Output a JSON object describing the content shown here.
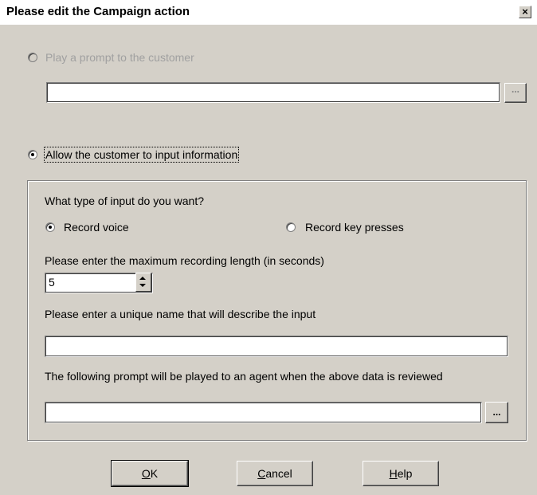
{
  "window": {
    "title": "Please edit the Campaign action",
    "close_glyph": "✕"
  },
  "play_prompt": {
    "label": "Play a prompt to the customer",
    "value": "",
    "browse_label": "..."
  },
  "allow_input": {
    "label": "Allow the customer to input information"
  },
  "input_type": {
    "question": "What type of input do you want?",
    "record_voice_label": "Record voice",
    "record_keys_label": "Record key presses"
  },
  "max_length": {
    "label": "Please enter the maximum recording length (in seconds)",
    "value": "5"
  },
  "unique_name": {
    "label": "Please enter a unique name that will describe the input",
    "value": ""
  },
  "agent_prompt": {
    "label": "The following prompt will be played to an agent when the above data is reviewed",
    "value": "",
    "browse_label": "..."
  },
  "buttons": {
    "ok_accel": "O",
    "ok_rest": "K",
    "cancel_accel": "C",
    "cancel_rest": "ancel",
    "help_accel": "H",
    "help_rest": "elp"
  }
}
